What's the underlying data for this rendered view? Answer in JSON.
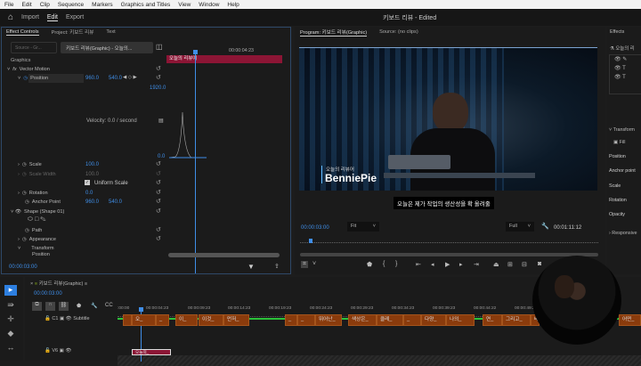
{
  "menu": [
    "File",
    "Edit",
    "Clip",
    "Sequence",
    "Markers",
    "Graphics and Titles",
    "View",
    "Window",
    "Help"
  ],
  "header": {
    "import": "Import",
    "edit": "Edit",
    "export": "Export",
    "title": "키보드 리뷰 - Edited"
  },
  "effect_controls": {
    "tabs": [
      "Effect Controls",
      "Project: 키보드 리뷰",
      "Text"
    ],
    "source": "Source - Gr...",
    "clip": "키보드 리뷰(Graphic) - 오늘의...",
    "timecode_head": "00:00:04:23",
    "clip_bar": "오늘의 리뷰어",
    "graphics": "Graphics",
    "vector_motion": "Vector Motion",
    "position": {
      "label": "Position",
      "x": "960.0",
      "y": "540.0"
    },
    "graph_max": "1920.0",
    "graph_min": "0.0",
    "velocity": "Velocity: 0.0 / second",
    "scale": {
      "label": "Scale",
      "value": "100.0"
    },
    "scale_width": {
      "label": "Scale Width",
      "value": "100.0"
    },
    "uniform_scale": "Uniform Scale",
    "rotation": {
      "label": "Rotation",
      "value": "0.0"
    },
    "anchor": {
      "label": "Anchor Point",
      "x": "960.0",
      "y": "540.0"
    },
    "shape": "Shape (Shape 01)",
    "path": "Path",
    "appearance": "Appearance",
    "transform": "Transform",
    "position2": "Position",
    "timecode": "00:00:03:00"
  },
  "program": {
    "tabs": [
      "Program: 키보드 리뷰(Graphic)",
      "Source: (no clips)"
    ],
    "lower_third_small": "오늘의 리뷰어",
    "lower_third_name": "BenniePie",
    "caption": "오늘은 제가 작업의 생산성을 확 올려줄",
    "timecode": "00:00:03:00",
    "fit": "Fit",
    "quality": "Full",
    "duration": "00:01:11:12"
  },
  "effects": {
    "title": "Effects",
    "layer": "오늘의 리",
    "transform": "Transform",
    "fill": "Fill",
    "props": [
      "Position",
      "Anchor point",
      "Scale",
      "Rotation",
      "Opacity"
    ],
    "responsive": "Responsive"
  },
  "timeline": {
    "title": "키보드 리뷰(Graphic)",
    "timecode": "00:00:03:00",
    "ticks": [
      ":00:00",
      "00:00:04:23",
      "00:00:09:23",
      "00:00:14:23",
      "00:00:19:23",
      "00:00:24:23",
      "00:00:29:23",
      "00:00:34:23",
      "00:00:39:23",
      "00:00:44:22",
      "00:00:49:2"
    ],
    "track_c1": "C1",
    "track_c1_name": "Subtitle",
    "track_v6": "V6",
    "captions": [
      "오_",
      "_",
      "이_",
      "이것_",
      "먼저_",
      "_",
      "_",
      "뛰어난_",
      "색상은_",
      "클레_",
      "_",
      "다양_",
      "나의_",
      "연_",
      "그리고_",
      "배",
      "어떤_"
    ],
    "graphic_clip": "오늘의_"
  }
}
